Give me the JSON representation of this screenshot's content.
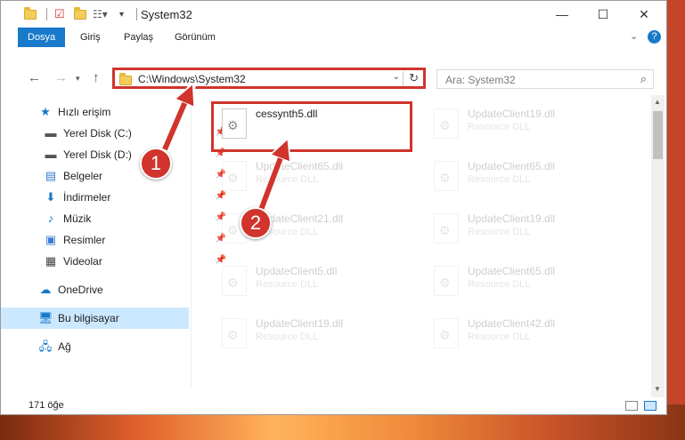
{
  "window": {
    "title": "System32"
  },
  "ribbon": {
    "tabs": [
      "Dosya",
      "Giriş",
      "Paylaş",
      "Görünüm"
    ]
  },
  "address": {
    "path": "C:\\Windows\\System32",
    "search_placeholder": "Ara: System32"
  },
  "sidebar": {
    "items": [
      {
        "label": "Hızlı erişim",
        "icon": "star-icon"
      },
      {
        "label": "Yerel Disk (C:)",
        "icon": "drive-icon"
      },
      {
        "label": "Yerel Disk (D:)",
        "icon": "drive-icon"
      },
      {
        "label": "Belgeler",
        "icon": "documents-icon"
      },
      {
        "label": "İndirmeler",
        "icon": "download-icon"
      },
      {
        "label": "Müzik",
        "icon": "music-icon"
      },
      {
        "label": "Resimler",
        "icon": "pictures-icon"
      },
      {
        "label": "Videolar",
        "icon": "videos-icon"
      },
      {
        "label": "OneDrive",
        "icon": "cloud-icon"
      },
      {
        "label": "Bu bilgisayar",
        "icon": "computer-icon"
      },
      {
        "label": "Ağ",
        "icon": "network-icon"
      }
    ]
  },
  "files": [
    {
      "name": "cessynth5.dll",
      "type": ""
    },
    {
      "name": "UpdateClient19.dll",
      "type": "Resource DLL"
    },
    {
      "name": "UpdateClient65.dll",
      "type": "Resource DLL"
    },
    {
      "name": "UpdateClient65.dll",
      "type": "Resource DLL"
    },
    {
      "name": "UpdateClient21.dll",
      "type": "Resource DLL"
    },
    {
      "name": "UpdateClient19.dll",
      "type": "Resource DLL"
    },
    {
      "name": "UpdateClient5.dll",
      "type": "Resource DLL"
    },
    {
      "name": "UpdateClient65.dll",
      "type": "Resource DLL"
    },
    {
      "name": "UpdateClient19.dll",
      "type": "Resource DLL"
    },
    {
      "name": "UpdateClient42.dll",
      "type": "Resource DLL"
    }
  ],
  "status": {
    "count": "171 öğe"
  },
  "annotations": {
    "step1": "1",
    "step2": "2",
    "color": "#d0342c"
  },
  "colors": {
    "accent": "#1979ca",
    "selection": "#cce8ff"
  }
}
